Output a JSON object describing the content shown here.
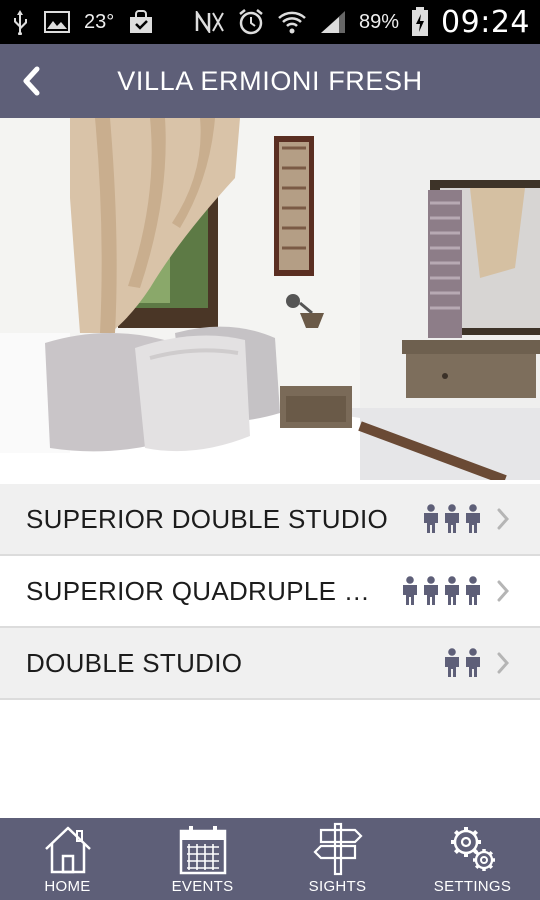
{
  "status_bar": {
    "temperature": "23°",
    "battery": "89%",
    "time": "09:24"
  },
  "header": {
    "title": "VILLA ERMIONI FRESH"
  },
  "rooms": [
    {
      "name": "SUPERIOR DOUBLE STUDIO",
      "guests": 3
    },
    {
      "name": "SUPERIOR QUADRUPLE STUDIO",
      "guests": 4
    },
    {
      "name": "DOUBLE STUDIO",
      "guests": 2
    }
  ],
  "bottom_nav": [
    {
      "label": "HOME",
      "icon": "home-icon"
    },
    {
      "label": "EVENTS",
      "icon": "calendar-icon"
    },
    {
      "label": "SIGHTS",
      "icon": "signpost-icon"
    },
    {
      "label": "SETTINGS",
      "icon": "gears-icon"
    }
  ],
  "colors": {
    "bar": "#5e5f78",
    "person_icon": "#5e5f78"
  }
}
